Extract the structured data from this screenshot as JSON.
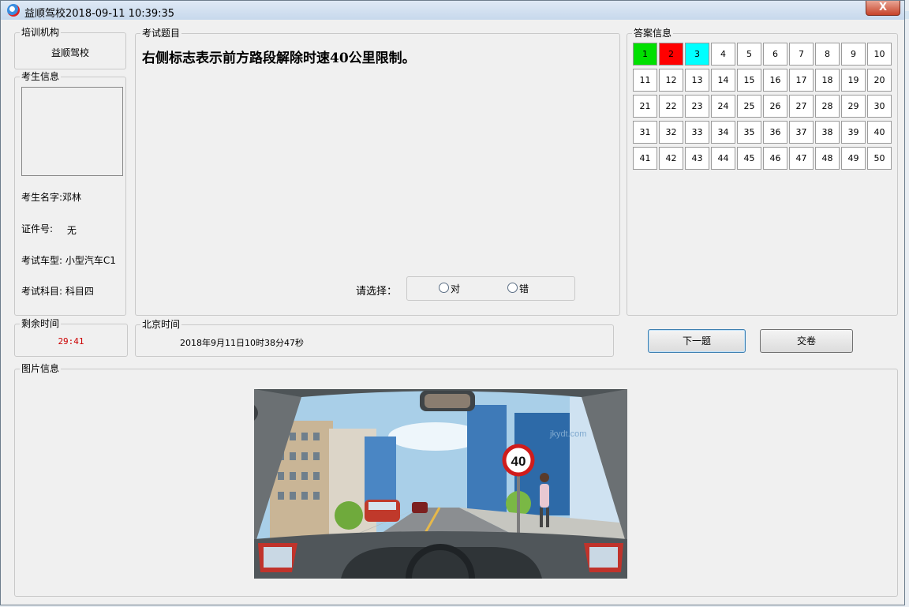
{
  "window": {
    "title": "益顺驾校2018-09-11 10:39:35",
    "close_label": "X"
  },
  "training_org": {
    "legend": "培训机构",
    "name": "益顺驾校"
  },
  "candidate": {
    "legend": "考生信息",
    "name_label": "考生名字:",
    "name_value": "邓林",
    "id_label": "证件号:",
    "id_value": "无",
    "vehicle_label": "考试车型:",
    "vehicle_value": "小型汽车C1",
    "subject_label": "考试科目:",
    "subject_value": "科目四"
  },
  "question": {
    "legend": "考试题目",
    "text": "右侧标志表示前方路段解除时速40公里限制。",
    "choose_label": "请选择：",
    "options": [
      "对",
      "错"
    ]
  },
  "answers": {
    "legend": "答案信息",
    "cells": [
      "1",
      "2",
      "3",
      "4",
      "5",
      "6",
      "7",
      "8",
      "9",
      "10",
      "11",
      "12",
      "13",
      "14",
      "15",
      "16",
      "17",
      "18",
      "19",
      "20",
      "21",
      "22",
      "23",
      "24",
      "25",
      "26",
      "27",
      "28",
      "29",
      "30",
      "31",
      "32",
      "33",
      "34",
      "35",
      "36",
      "37",
      "38",
      "39",
      "40",
      "41",
      "42",
      "43",
      "44",
      "45",
      "46",
      "47",
      "48",
      "49",
      "50"
    ],
    "status_colors": {
      "1": "#00e000",
      "2": "#ff0000",
      "3": "#00ffff"
    }
  },
  "remaining": {
    "legend": "剩余时间",
    "value": "29:41",
    "color": "#cc0000"
  },
  "beijing_time": {
    "legend": "北京时间",
    "value": "2018年9月11日10时38分47秒"
  },
  "buttons": {
    "next": "下一题",
    "submit": "交卷"
  },
  "picture": {
    "legend": "图片信息",
    "sign_value": "40",
    "watermark": "驾考一点通 jkydt.com"
  }
}
